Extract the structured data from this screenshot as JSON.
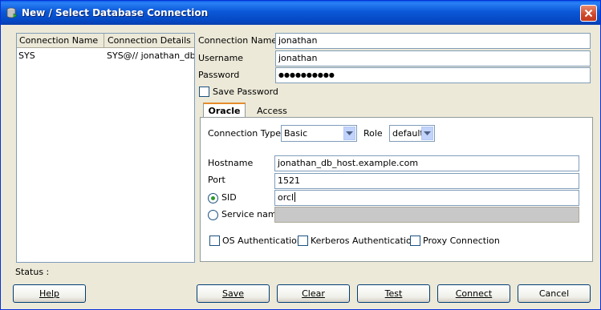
{
  "window": {
    "title": "New / Select Database Connection"
  },
  "connections": {
    "headers": [
      "Connection Name",
      "Connection Details"
    ],
    "rows": [
      {
        "name": "SYS",
        "details": "SYS@// jonathan_db..."
      }
    ]
  },
  "form": {
    "connection_name_label": "Connection Name",
    "connection_name_value": "jonathan",
    "username_label": "Username",
    "username_value": "jonathan",
    "password_label": "Password",
    "password_value": "●●●●●●●●●●",
    "save_password_label": "Save Password"
  },
  "tabs": {
    "oracle": "Oracle",
    "access": "Access"
  },
  "oracle": {
    "connection_type_label": "Connection Type",
    "connection_type_value": "Basic",
    "role_label": "Role",
    "role_value": "default",
    "hostname_label": "Hostname",
    "hostname_value": "jonathan_db_host.example.com",
    "port_label": "Port",
    "port_value": "1521",
    "sid_label": "SID",
    "sid_value": "orcl",
    "service_name_label": "Service name",
    "service_name_value": "",
    "os_auth_label": "OS Authentication",
    "kerberos_label": "Kerberos Authentication",
    "proxy_label": "Proxy Connection"
  },
  "status": {
    "label": "Status :"
  },
  "buttons": {
    "help": "Help",
    "save": "Save",
    "clear": "Clear",
    "test": "Test",
    "connect": "Connect",
    "cancel": "Cancel"
  },
  "colors": {
    "titlebar": "#0b58d8",
    "dialog_bg": "#ece9d8",
    "active_tab_accent": "#e68b2c",
    "radio_dot": "#2a9a2a"
  }
}
